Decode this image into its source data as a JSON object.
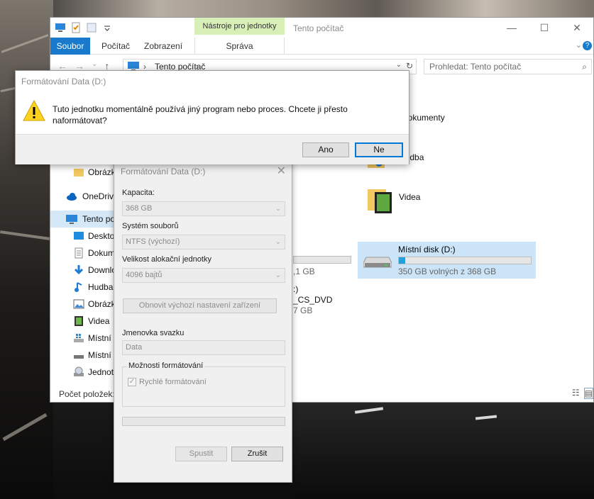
{
  "explorer": {
    "title": "Tento počítač",
    "tools_tab": "Nástroje pro jednotky",
    "tabs": [
      "Soubor",
      "Počítač",
      "Zobrazení"
    ],
    "manage_tab": "Správa",
    "address": "Tento počítač",
    "search_placeholder": "Prohledat: Tento počítač",
    "sidebar": [
      {
        "label": "Obrázky",
        "icon": "folder-icon"
      },
      {
        "label": "OneDrive",
        "icon": "onedrive-icon"
      },
      {
        "label": "Tento počítač",
        "icon": "pc-icon"
      },
      {
        "label": "Desktop",
        "icon": "desktop-icon"
      },
      {
        "label": "Dokumenty",
        "icon": "documents-icon"
      },
      {
        "label": "Downloads",
        "icon": "download-icon"
      },
      {
        "label": "Hudba",
        "icon": "music-icon"
      },
      {
        "label": "Obrázky",
        "icon": "pictures-icon"
      },
      {
        "label": "Videa",
        "icon": "video-icon"
      },
      {
        "label": "Místní disk",
        "icon": "drive-icon"
      },
      {
        "label": "Místní disk",
        "icon": "drive-icon"
      },
      {
        "label": "Jednotka",
        "icon": "dvd-drive-icon"
      }
    ],
    "folders": [
      {
        "label": "Dokumenty"
      },
      {
        "label": "Hudba"
      },
      {
        "label": "Videa"
      }
    ],
    "drive_d": {
      "label": "Místní disk (D:)",
      "free": "350 GB volných z 368 GB",
      "used_fraction": 0.05
    },
    "partial_texts": [
      ",1 GB",
      "_CS_DVD",
      "7 GB",
      ":)"
    ],
    "status": "Počet položek:"
  },
  "format_dialog": {
    "title": "Formátování Data (D:)",
    "capacity_label": "Kapacita:",
    "capacity_value": "368 GB",
    "fs_label": "Systém souborů",
    "fs_value": "NTFS (výchozí)",
    "alloc_label": "Velikost alokační jednotky",
    "alloc_value": "4096 bajtů",
    "restore_button": "Obnovit výchozí nastavení zařízení",
    "volume_label": "Jmenovka svazku",
    "volume_value": "Data",
    "options_label": "Možnosti formátování",
    "quick_format": "Rychlé formátování",
    "start_button": "Spustit",
    "cancel_button": "Zrušit"
  },
  "message_box": {
    "title": "Formátování Data (D:)",
    "text": "Tuto jednotku momentálně používá jiný program nebo proces. Chcete ji přesto naformátovat?",
    "yes_button": "Ano",
    "no_button": "Ne"
  }
}
